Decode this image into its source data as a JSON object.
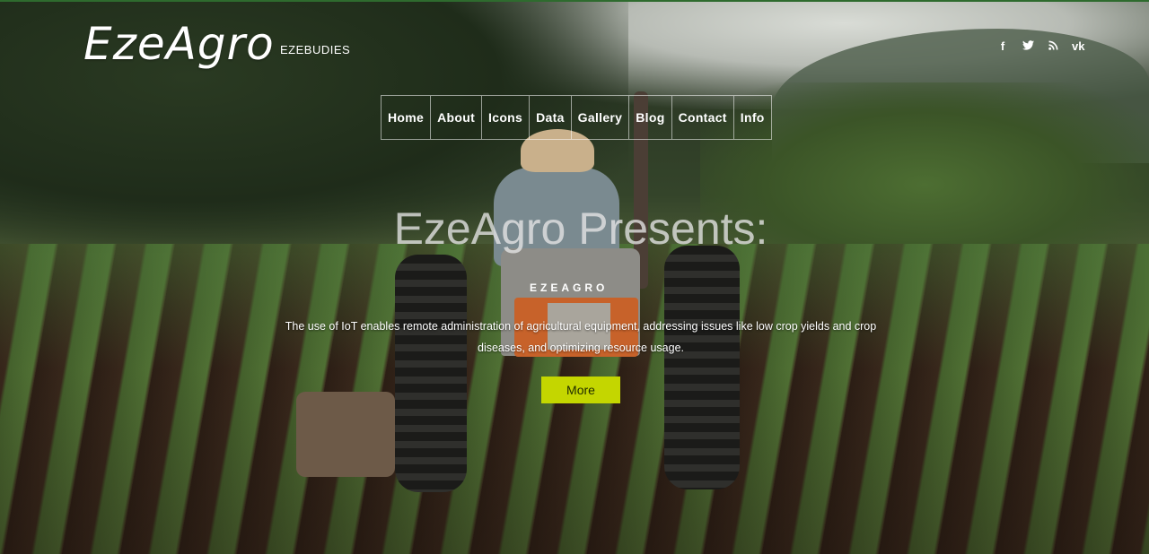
{
  "brand": {
    "name": "EzeAgro",
    "tagline": "EZEBUDIES"
  },
  "social": [
    {
      "icon": "facebook-icon",
      "glyph": "f"
    },
    {
      "icon": "twitter-icon",
      "glyph": "🐦"
    },
    {
      "icon": "rss-icon",
      "glyph": "⌇"
    },
    {
      "icon": "vk-icon",
      "glyph": "vk"
    }
  ],
  "nav": [
    {
      "label": "Home"
    },
    {
      "label": "About"
    },
    {
      "label": "Icons"
    },
    {
      "label": "Data"
    },
    {
      "label": "Gallery"
    },
    {
      "label": "Blog"
    },
    {
      "label": "Contact"
    },
    {
      "label": "Info"
    }
  ],
  "hero": {
    "title": "EzeAgro Presents:",
    "description": "The use of IoT enables remote administration of agricultural equipment, addressing issues like low crop yields and crop diseases, and optimizing resource usage.",
    "cta": "More",
    "tractor_label": "EZEAGRO"
  },
  "colors": {
    "accent": "#c4d600",
    "text": "#ffffff"
  }
}
